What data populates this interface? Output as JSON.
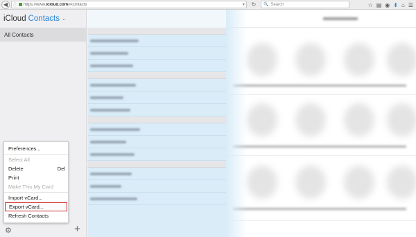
{
  "browser": {
    "url_prefix": "https://www.",
    "url_domain": "icloud.com",
    "url_path": "/#contacts",
    "search_placeholder": "Search"
  },
  "app": {
    "brand": "iCloud",
    "section": "Contacts"
  },
  "sidebar": {
    "groups": [
      {
        "label": "All Contacts",
        "selected": true
      }
    ]
  },
  "menu": {
    "items": [
      {
        "label": "Preferences...",
        "shortcut": "",
        "disabled": false
      },
      {
        "label": "Select All",
        "shortcut": "",
        "disabled": true
      },
      {
        "label": "Delete",
        "shortcut": "Del",
        "disabled": false
      },
      {
        "label": "Print",
        "shortcut": "",
        "disabled": false
      },
      {
        "label": "Make This My Card",
        "shortcut": "",
        "disabled": true
      },
      {
        "label": "Import vCard...",
        "shortcut": "",
        "disabled": false
      },
      {
        "label": "Export vCard...",
        "shortcut": "",
        "disabled": false,
        "highlighted": true
      },
      {
        "label": "Refresh Contacts",
        "shortcut": "",
        "disabled": false
      }
    ]
  },
  "colors": {
    "accent": "#2a85d6",
    "highlight_outline": "#d42a2a",
    "list_bg": "#d9ecf8"
  }
}
